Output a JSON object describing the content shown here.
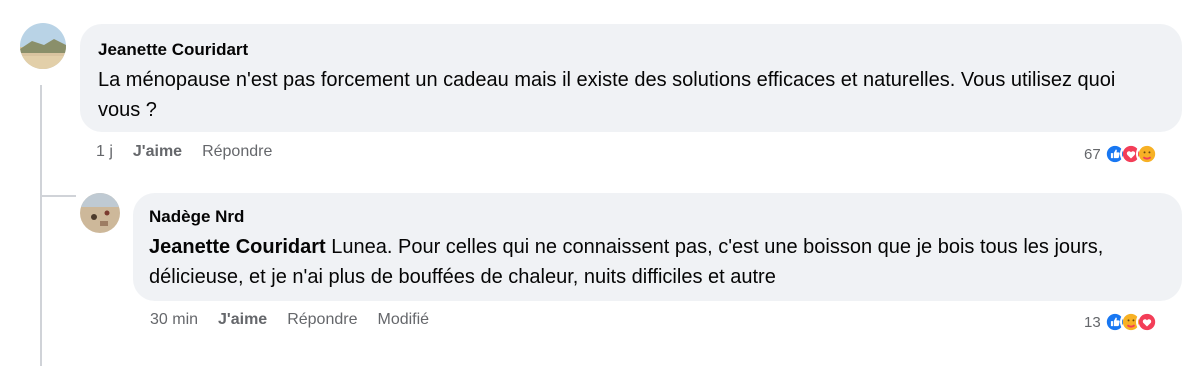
{
  "comments": [
    {
      "author": "Jeanette Couridart",
      "text": "La ménopause n'est pas forcement un cadeau mais il existe des solutions efficaces et naturelles. Vous utilisez quoi vous ?",
      "time": "1 j",
      "like_label": "J'aime",
      "reply_label": "Répondre",
      "reaction_count": "67",
      "reactions": [
        "like-icon",
        "love-icon",
        "care-icon"
      ]
    },
    {
      "author": "Nadège Nrd",
      "mention": "Jeanette Couridart",
      "text": " Lunea. Pour celles qui ne connaissent pas, c'est une boisson que je bois tous les jours, délicieuse, et je n'ai plus de bouffées de chaleur, nuits difficiles et autre",
      "time": "30 min",
      "like_label": "J'aime",
      "reply_label": "Répondre",
      "edited_label": "Modifié",
      "reaction_count": "13",
      "reactions": [
        "like-icon",
        "care-icon",
        "love-icon"
      ]
    }
  ],
  "colors": {
    "like": "#1877f2",
    "love": "#f33e58",
    "care": "#f7b125"
  }
}
